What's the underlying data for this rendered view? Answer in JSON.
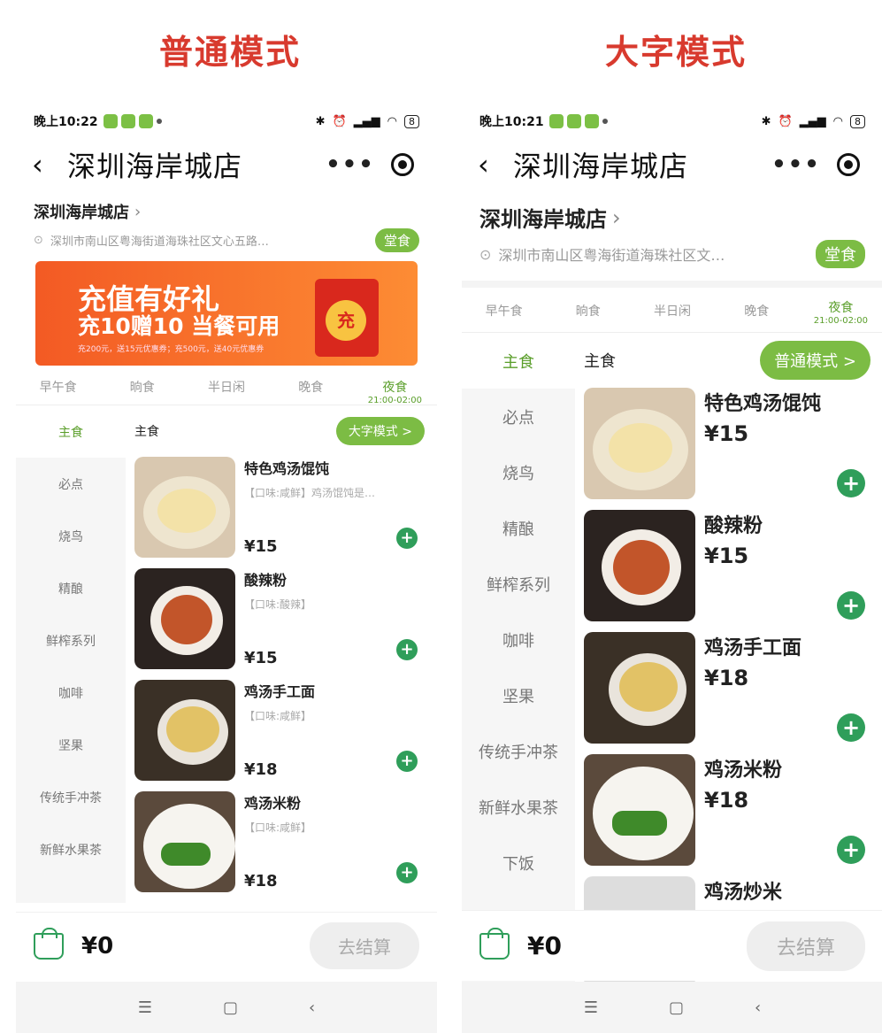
{
  "headings": {
    "normal": "普通模式",
    "large": "大字模式"
  },
  "colors": {
    "accent_green": "#7cbc44",
    "add_green": "#2f9e5a",
    "heading_red": "#d83a2e"
  },
  "phones": [
    {
      "status": {
        "time": "晚上10:22",
        "battery": "8"
      },
      "title": "深圳海岸城店",
      "shop_name": "深圳海岸城店",
      "address": "深圳市南山区粤海街道海珠社区文心五路…",
      "dine_badge": "堂食",
      "banner": {
        "line1": "充值有好礼",
        "line2": "充10赠10 当餐可用",
        "line3": "充200元，送15元优惠券；充500元，送40元优惠券",
        "coin": "充"
      },
      "meal_tabs": [
        "早午食",
        "晌食",
        "半日闲",
        "晚食",
        "夜食"
      ],
      "active_tab_time": "21:00-02:00",
      "category_title": "主食",
      "mode_button": "大字模式 >",
      "sidebar": [
        "主食",
        "必点",
        "烧鸟",
        "精酿",
        "鲜榨系列",
        "咖啡",
        "坚果",
        "传统手冲茶",
        "新鲜水果茶"
      ],
      "dishes": [
        {
          "name": "特色鸡汤馄饨",
          "desc": "【口味:咸鲜】鸡汤馄饨是…",
          "price": "¥15"
        },
        {
          "name": "酸辣粉",
          "desc": "【口味:酸辣】",
          "price": "¥15"
        },
        {
          "name": "鸡汤手工面",
          "desc": "【口味:咸鲜】",
          "price": "¥18"
        },
        {
          "name": "鸡汤米粉",
          "desc": "【口味:咸鲜】",
          "price": "¥18"
        }
      ],
      "cart_total": "¥0",
      "checkout": "去结算"
    },
    {
      "status": {
        "time": "晚上10:21",
        "battery": "8"
      },
      "title": "深圳海岸城店",
      "shop_name": "深圳海岸城店",
      "address": "深圳市南山区粤海街道海珠社区文…",
      "dine_badge": "堂食",
      "meal_tabs": [
        "早午食",
        "晌食",
        "半日闲",
        "晚食",
        "夜食"
      ],
      "active_tab_time": "21:00-02:00",
      "category_title": "主食",
      "mode_button": "普通模式 >",
      "sidebar": [
        "主食",
        "必点",
        "烧鸟",
        "精酿",
        "鲜榨系列",
        "咖啡",
        "坚果",
        "传统手冲茶",
        "新鲜水果茶",
        "下饭"
      ],
      "dishes": [
        {
          "name": "特色鸡汤馄饨",
          "price": "¥15"
        },
        {
          "name": "酸辣粉",
          "price": "¥15"
        },
        {
          "name": "鸡汤手工面",
          "price": "¥18"
        },
        {
          "name": "鸡汤米粉",
          "price": "¥18"
        },
        {
          "name": "鸡汤炒米"
        }
      ],
      "cart_total": "¥0",
      "checkout": "去结算"
    }
  ]
}
